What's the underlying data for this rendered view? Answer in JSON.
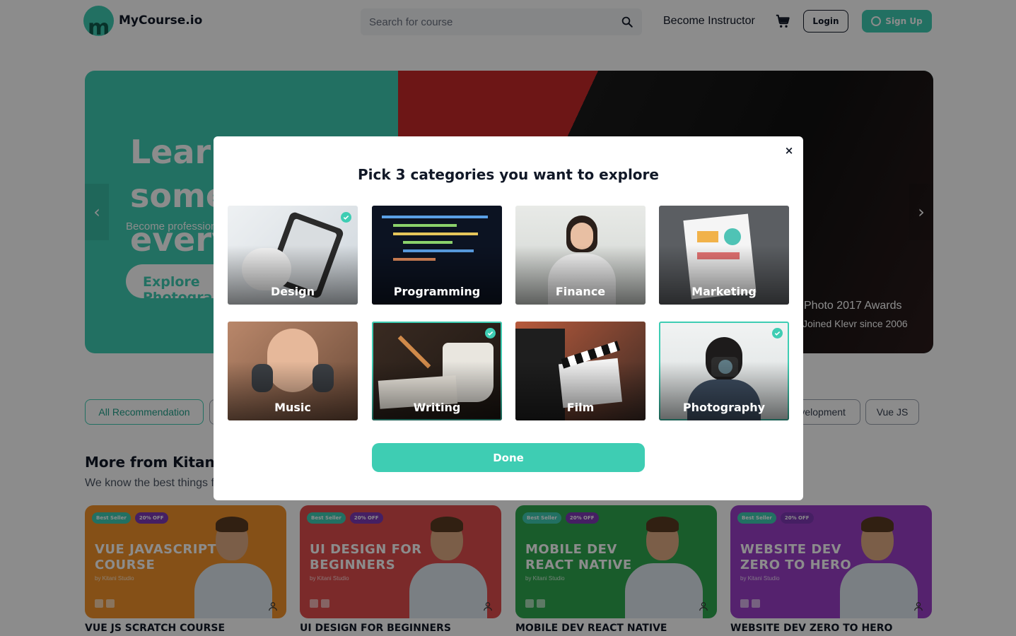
{
  "header": {
    "brand": "MyCourse.io",
    "logo_letter": "m",
    "search_placeholder": "Search for course",
    "become_instructor": "Become Instructor",
    "login": "Login",
    "signup": "Sign Up"
  },
  "hero": {
    "title": "Learn something new everyday",
    "subtitle": "Become professionals and ready to join the world.",
    "cta": "Explore Photography",
    "award": "Photo 2017 Awards",
    "joined": "Joined Klevr since 2006",
    "prev_arrow": "‹",
    "next_arrow": "›"
  },
  "filters": {
    "all": "All Recommendation",
    "development": "Web Development",
    "vue": "Vue JS"
  },
  "section": {
    "title": "More from Kitani Studio",
    "subtitle": "We know the best things for you. Top picks for you."
  },
  "courses": [
    {
      "badge_seller": "Best Seller",
      "badge_off": "20% OFF",
      "title": "VUE JAVASCRIPT COURSE",
      "by": "by Kitani Studio",
      "name": "VUE JS SCRATCH COURSE",
      "color": "#f2922a"
    },
    {
      "badge_seller": "Best Seller",
      "badge_off": "20% OFF",
      "title": "UI DESIGN FOR BEGINNERS",
      "by": "by Kitani Studio",
      "name": "UI DESIGN FOR BEGINNERS",
      "color": "#e14d4d"
    },
    {
      "badge_seller": "Best Seller",
      "badge_off": "20% OFF",
      "title": "MOBILE DEV REACT NATIVE",
      "by": "by Kitani Studio",
      "name": "MOBILE DEV REACT NATIVE",
      "color": "#2fa84f"
    },
    {
      "badge_seller": "Best Seller",
      "badge_off": "20% OFF",
      "title": "WEBSITE DEV ZERO TO HERO",
      "by": "by Kitani Studio",
      "name": "WEBSITE DEV ZERO TO HERO",
      "color": "#9b3fc9"
    }
  ],
  "modal": {
    "title": "Pick 3 categories you want to explore",
    "close": "×",
    "done": "Done",
    "categories": [
      {
        "label": "Design",
        "selected": true
      },
      {
        "label": "Programming",
        "selected": false
      },
      {
        "label": "Finance",
        "selected": false
      },
      {
        "label": "Marketing",
        "selected": false
      },
      {
        "label": "Music",
        "selected": false
      },
      {
        "label": "Writing",
        "selected": true
      },
      {
        "label": "Film",
        "selected": false
      },
      {
        "label": "Photography",
        "selected": true
      }
    ]
  },
  "colors": {
    "accent": "#3ecdb3",
    "purple_badge": "#7e3ab5"
  }
}
